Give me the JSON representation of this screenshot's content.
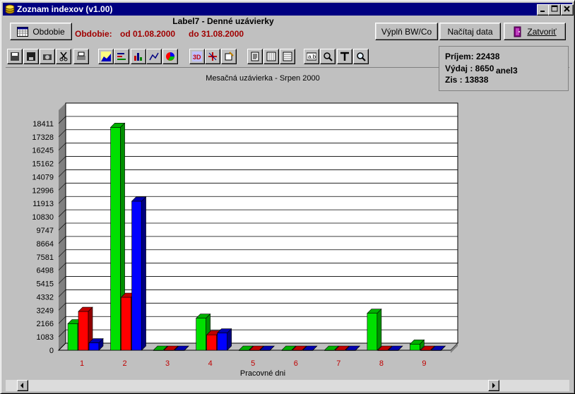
{
  "window": {
    "title": "Zoznam indexov (v1.00)"
  },
  "header": {
    "report_title": "Label7 - Denné uzávierky",
    "period_label": "Obdobie:",
    "date_from": "od 01.08.2000",
    "date_to": "do 31.08.2000",
    "obdobie_button": "Obdobie",
    "fill_button": "Výplň BW/Co",
    "load_button": "Načítaj data",
    "close_button": "Zatvoriť"
  },
  "summary": {
    "income": "Príjem: 22438",
    "expense": "Výdaj :  8650",
    "stray_label": "anel3",
    "profit": "Zis    :  13838"
  },
  "toolbar": {
    "icons": [
      "save-icon",
      "disk-icon",
      "camera-icon",
      "cut-icon",
      "print-icon",
      "area-chart-icon",
      "hbar-chart-icon",
      "bar-chart-icon",
      "line-chart-icon",
      "pie-chart-icon",
      "3d-icon",
      "rotate-icon",
      "color-icon",
      "text-doc-icon",
      "grid-vert-icon",
      "grid-horz-icon",
      "label-icon",
      "zoom-tool-icon",
      "title-icon",
      "magnifier-icon"
    ]
  },
  "chart_data": {
    "type": "bar",
    "title": "Mesačná uzávierka - Srpen 2000",
    "xlabel": "Pracovné dni",
    "ylabel": "",
    "ylim": [
      0,
      19494
    ],
    "y_ticks": [
      0,
      1083,
      2166,
      3249,
      4332,
      5415,
      6498,
      7581,
      8664,
      9747,
      10830,
      11913,
      12996,
      14079,
      15162,
      16245,
      17328,
      18411
    ],
    "categories": [
      "1",
      "2",
      "3",
      "4",
      "5",
      "6",
      "7",
      "8",
      "9"
    ],
    "grid": true,
    "series": [
      {
        "color": "#00e000",
        "values": [
          2150,
          18100,
          0,
          2600,
          0,
          0,
          0,
          3000,
          500
        ]
      },
      {
        "color": "#ff0000",
        "values": [
          3150,
          4300,
          0,
          1250,
          0,
          0,
          0,
          0,
          0
        ]
      },
      {
        "color": "#0000ff",
        "values": [
          600,
          12100,
          0,
          1400,
          0,
          0,
          0,
          0,
          0
        ]
      }
    ]
  }
}
